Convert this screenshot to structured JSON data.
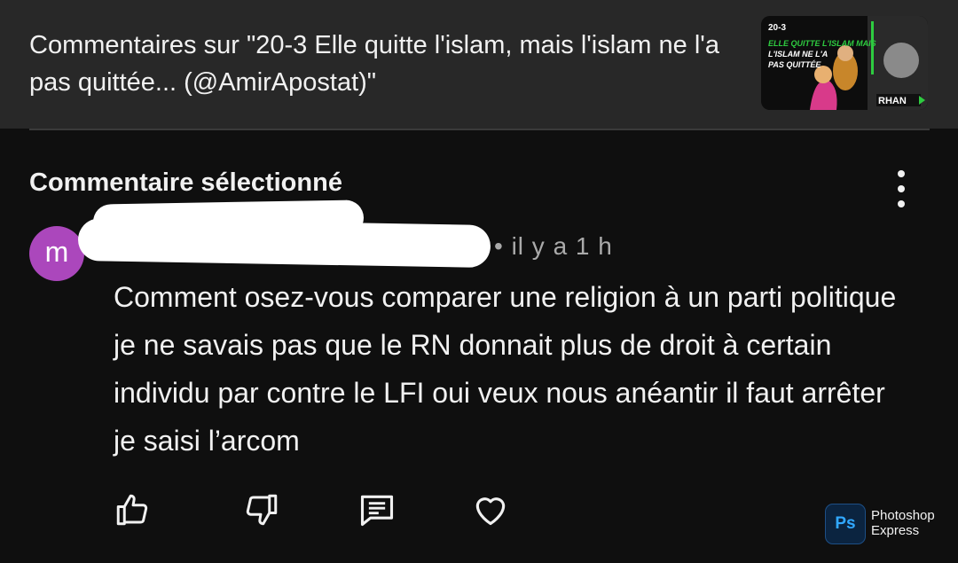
{
  "header": {
    "title": "Commentaires sur \"20-3 Elle quitte l'islam, mais l'islam ne l'a pas quittée... (@AmirApostat)\"",
    "thumbnail": {
      "line1": "20-3",
      "line2": "ELLE QUITTE L'ISLAM MAIS",
      "line3": "L'ISLAM NE L'A",
      "line4": "PAS QUITTÉE",
      "brand": "RHAN"
    }
  },
  "section": {
    "title": "Commentaire sélectionné"
  },
  "comment": {
    "avatar_letter": "m",
    "avatar_color": "#ab47bc",
    "timestamp": "• il y a 1 h",
    "text": "Comment osez-vous comparer une religion à un parti politique je ne savais pas que le RN donnait plus de droit à certain individu par contre le LFI oui veux nous anéantir il faut arrêter je saisi l’arcom"
  },
  "actions": {
    "icons": [
      "like-icon",
      "dislike-icon",
      "reply-icon",
      "heart-icon"
    ]
  },
  "watermark": {
    "badge": "Ps",
    "line1": "Photoshop",
    "line2": "Express"
  }
}
